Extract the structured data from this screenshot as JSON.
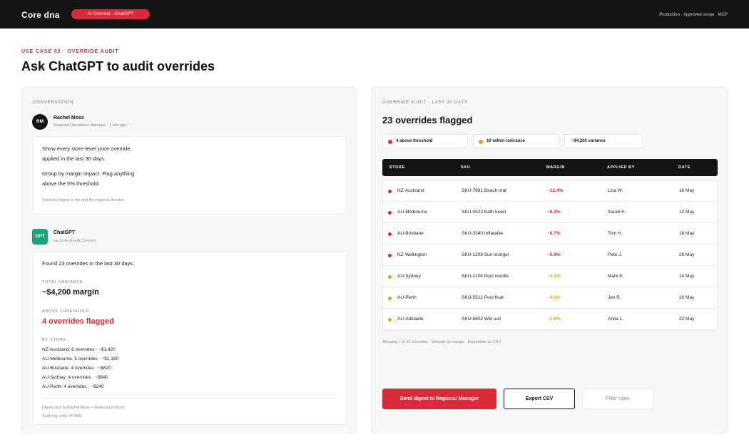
{
  "topbar": {
    "brand": "Core dna",
    "pill": "AI Connect · ChatGPT",
    "meta": "Production · Approved scope · MCP"
  },
  "header": {
    "eyebrow": "USE CASE 02 · OVERRIDE AUDIT",
    "title": "Ask ChatGPT to audit overrides"
  },
  "conversation": {
    "label": "CONVERSATION",
    "user": {
      "initials": "RM",
      "name": "Rachel Moss",
      "subtitle": "Regional Operations Manager · 2 min ago",
      "para1_line1": "Show every store-level price override",
      "para1_line2": "applied in the last 30 days.",
      "para2_line1": "Group by margin impact. Flag anything",
      "para2_line2": "above the 5% threshold.",
      "note": "Send the digest to me and the regional director."
    },
    "assistant": {
      "initials": "GPT",
      "name": "ChatGPT",
      "subtitle": "via Core dna AI Connect",
      "intro": "Found 23 overrides in the last 30 days.",
      "total_variance_label": "TOTAL VARIANCE",
      "total_variance_value": "~$4,200 margin",
      "above_threshold_label": "ABOVE THRESHOLD",
      "above_threshold_value": "4 overrides flagged",
      "by_store_label": "BY STORE",
      "by_store": [
        "NZ-Auckland: 6 overrides · ~$1,420",
        "AU-Melbourne: 5 overrides · ~$1,180",
        "AU-Brisbane: 4 overrides · ~$820",
        "AU-Sydney: 4 overrides · ~$540",
        "AU-Perth: 4 overrides · ~$240"
      ],
      "footer_line1": "Digest sent to Rachel Moss + Regional Director",
      "footer_line2": "Audit log entry #47845"
    }
  },
  "audit": {
    "label": "OVERRIDE AUDIT · LAST 30 DAYS",
    "title": "23 overrides flagged",
    "chips": [
      {
        "text": "4 above threshold",
        "color": "#d92b3a"
      },
      {
        "text": "19 within tolerance",
        "color": "#e2a21f"
      },
      {
        "text": "~$4,200 variance"
      }
    ],
    "columns": [
      "STORE",
      "SKU",
      "MARGIN",
      "APPLIED BY",
      "DATE"
    ],
    "rows": [
      {
        "store": "NZ-Auckland",
        "sku": "SKU-7891 Beach mat",
        "margin": "−12.4%",
        "applied_by": "Lisa W.",
        "date": "16 May",
        "status": "red"
      },
      {
        "store": "AU-Melbourne",
        "sku": "SKU-4523 Bath towel",
        "margin": "−8.2%",
        "applied_by": "Sarah K.",
        "date": "12 May",
        "status": "red"
      },
      {
        "store": "AU-Brisbane",
        "sku": "SKU-3340 Inflatable",
        "margin": "−6.7%",
        "applied_by": "Tom H.",
        "date": "18 May",
        "status": "red"
      },
      {
        "store": "NZ-Wellington",
        "sku": "SKU-1208 Sun lounger",
        "margin": "−5.9%",
        "applied_by": "Pete J.",
        "date": "20 May",
        "status": "red"
      },
      {
        "store": "AU-Sydney",
        "sku": "SKU-2104 Pool noodle",
        "margin": "−3.1%",
        "applied_by": "Mark P.",
        "date": "14 May",
        "status": "amber"
      },
      {
        "store": "AU-Perth",
        "sku": "SKU-5512 Pool float",
        "margin": "−4.5%",
        "applied_by": "Jen R.",
        "date": "20 May",
        "status": "amber"
      },
      {
        "store": "AU-Adelaide",
        "sku": "SKU-6802 Wet suit",
        "margin": "−2.8%",
        "applied_by": "Anita L.",
        "date": "22 May",
        "status": "amber"
      }
    ],
    "status_colors": {
      "red": "#d92b3a",
      "amber": "#e2a21f"
    },
    "footnote": "Showing 7 of 23 overrides · Sortable by margin · Exportable as CSV",
    "buttons": {
      "send": "Send digest to Regional Manager",
      "export": "Export CSV",
      "filter": "Filter rules"
    }
  }
}
